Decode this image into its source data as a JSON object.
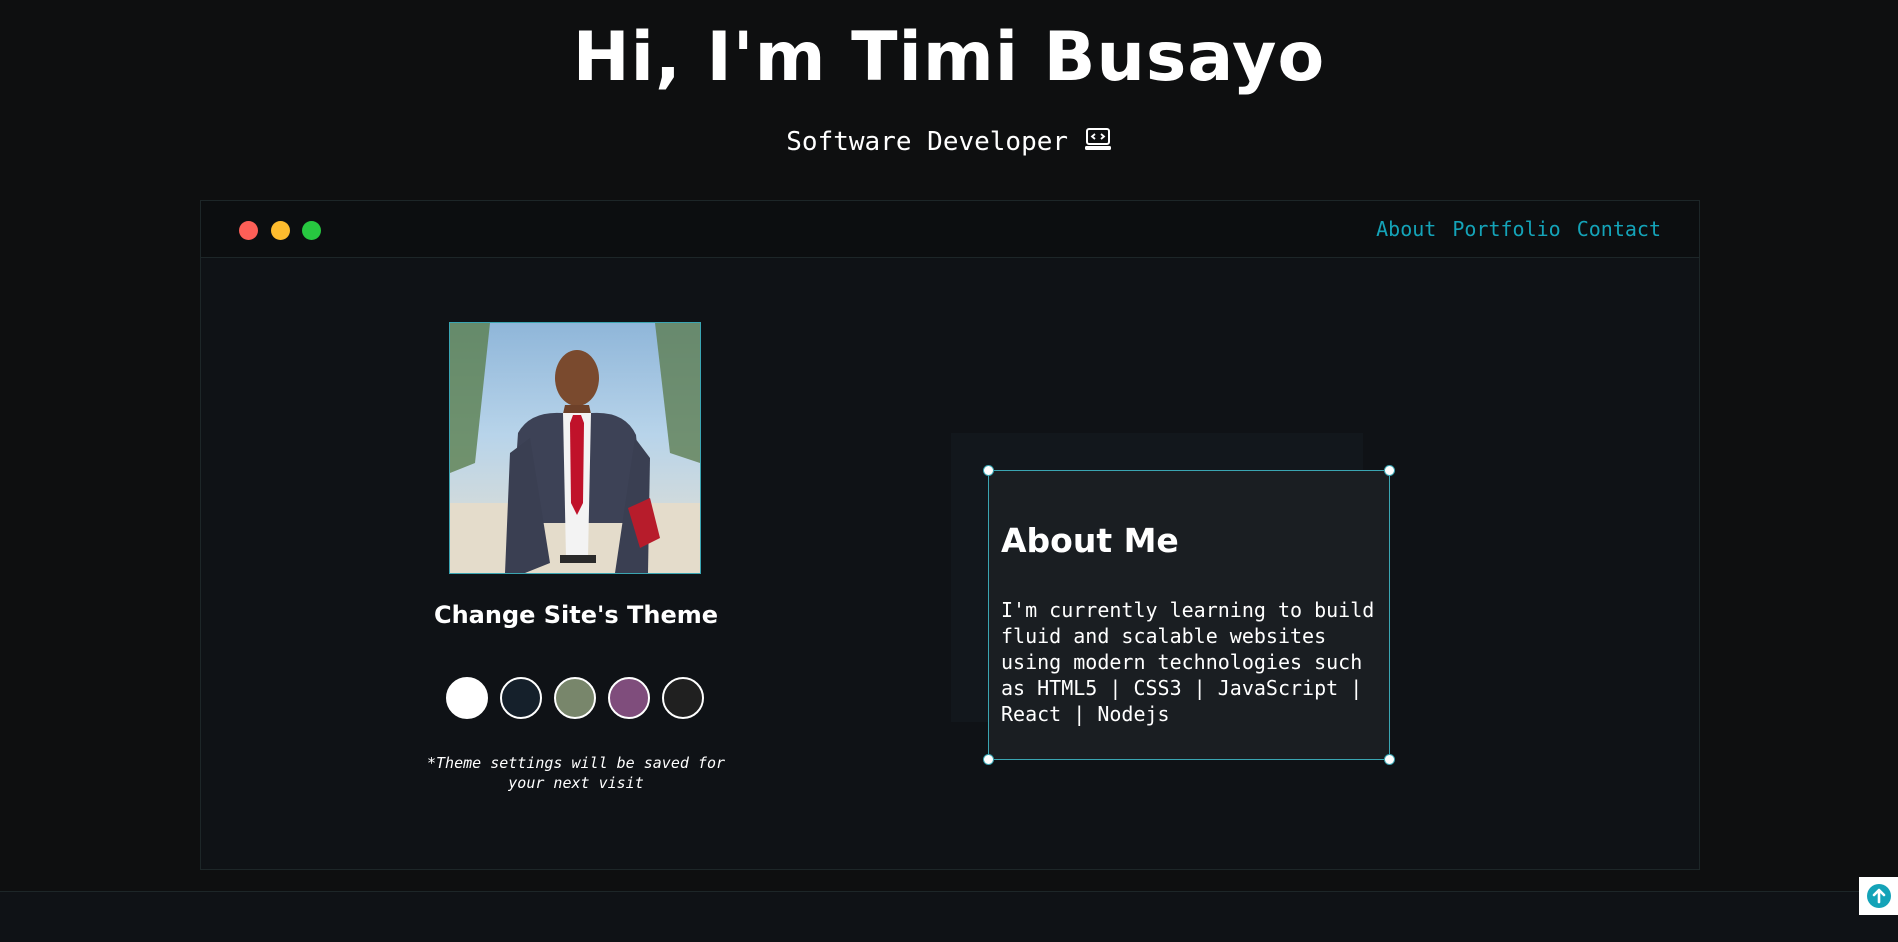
{
  "hero": {
    "title": "Hi, I'm Timi Busayo",
    "subtitle": "Software Developer",
    "subtitle_icon": "laptop-code-icon"
  },
  "window": {
    "controls": [
      "close-dot",
      "minimize-dot",
      "maximize-dot"
    ],
    "control_colors": [
      "#fd5f57",
      "#febc2e",
      "#27c840"
    ],
    "nav": [
      {
        "label": "About"
      },
      {
        "label": "Portfolio"
      },
      {
        "label": "Contact"
      }
    ],
    "nav_color": "#14a3b8"
  },
  "theme": {
    "title": "Change Site's Theme",
    "swatches": [
      {
        "name": "light",
        "color": "#ffffff"
      },
      {
        "name": "blue",
        "color": "#15202b"
      },
      {
        "name": "green",
        "color": "#78866b"
      },
      {
        "name": "purple",
        "color": "#7f4d7c"
      },
      {
        "name": "dark",
        "color": "#202020"
      }
    ],
    "note": "*Theme settings will be saved for your next visit"
  },
  "about": {
    "title": "About Me",
    "text": "I'm currently learning to build fluid and scalable websites using modern technologies such as HTML5 | CSS3 | JavaScript | React | Nodejs"
  },
  "scroll_top": {
    "icon": "arrow-up-circle-icon"
  }
}
